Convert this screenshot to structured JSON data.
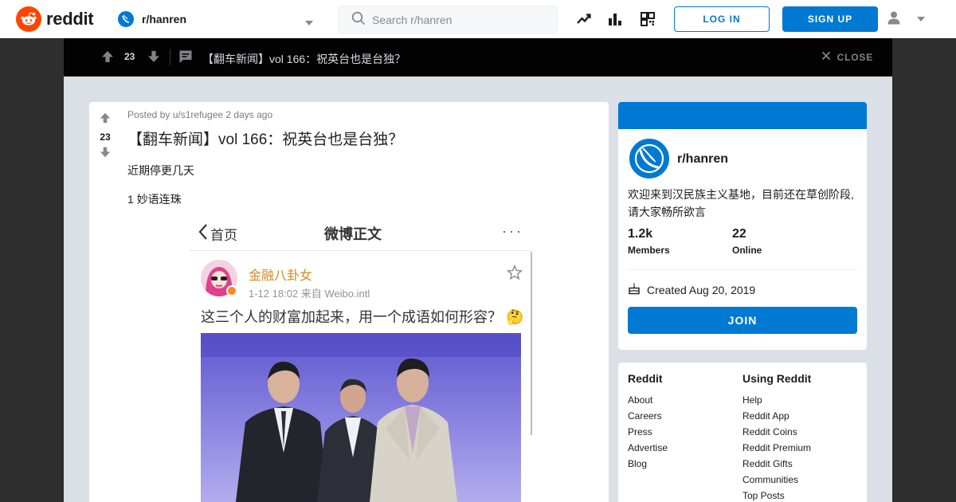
{
  "header": {
    "logo_text": "reddit",
    "community": "r/hanren",
    "search_placeholder": "Search r/hanren",
    "login_label": "LOG IN",
    "signup_label": "SIGN UP",
    "icons": [
      "trending-icon",
      "leaderboard-icon",
      "qr-code-icon",
      "user-icon"
    ]
  },
  "postbar": {
    "score": "23",
    "title": "【翻车新闻】vol 166：祝英台也是台独？",
    "close_label": "CLOSE"
  },
  "post": {
    "score": "23",
    "meta": "Posted by u/s1refugee 2 days ago",
    "title": "【翻车新闻】vol 166：祝英台也是台独？",
    "paragraphs": [
      "近期停更几天",
      "1 妙语连珠"
    ]
  },
  "weibo": {
    "back_label": "首页",
    "page_title": "微博正文",
    "more": "···",
    "author": "金融八卦女",
    "time_source": "1-12 18:02  来自 Weibo.intl",
    "text": "这三个人的财富加起来，用一个成语如何形容？",
    "colors": {
      "author": "#d68a1f",
      "photo_bg": "#7b78de"
    }
  },
  "community": {
    "name": "r/hanren",
    "description": "欢迎来到汉民族主义基地，目前还在草创阶段,请大家畅所欲言",
    "members_value": "1.2k",
    "members_label": "Members",
    "online_value": "22",
    "online_label": "Online",
    "created": "Created Aug 20, 2019",
    "join_label": "JOIN",
    "accent": "#0079d3"
  },
  "footer": {
    "col1_head": "Reddit",
    "col1_links": [
      "About",
      "Careers",
      "Press",
      "Advertise",
      "Blog"
    ],
    "col2_head": "Using Reddit",
    "col2_links": [
      "Help",
      "Reddit App",
      "Reddit Coins",
      "Reddit Premium",
      "Reddit Gifts",
      "Communities",
      "Top Posts"
    ]
  }
}
